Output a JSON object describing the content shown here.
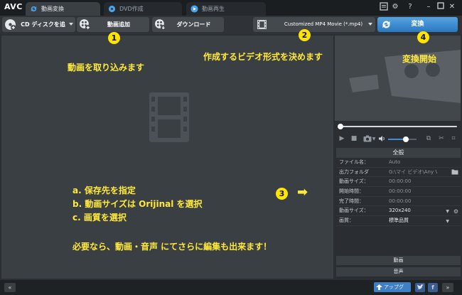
{
  "app": {
    "logo": "AVC"
  },
  "tabs": [
    {
      "label": "動画変換",
      "active": true
    },
    {
      "label": "DVD作成",
      "active": false
    },
    {
      "label": "動画再生",
      "active": false
    }
  ],
  "window_controls": {
    "help": "?"
  },
  "toolbar": {
    "add_cd_label": "CD ディスクを追加",
    "add_video_label": "動画追加",
    "download_label": "ダウンロード",
    "format_label": "Customized MP4 Movie (*.mp4)",
    "convert_label": "変換"
  },
  "props": {
    "header": "全般",
    "rows": [
      {
        "key": "ファイル名：",
        "value": "Auto"
      },
      {
        "key": "出力フォルダ",
        "value": "G:\\マイ ビデオ\\Any Vide..."
      },
      {
        "key": "動画サイズ：",
        "value": "00:00:00"
      },
      {
        "key": "開始時間：",
        "value": "00:00:00"
      },
      {
        "key": "完了時間：",
        "value": "00:00:00"
      },
      {
        "key": "動画サイズ：",
        "value": "320x240"
      },
      {
        "key": "画質：",
        "value": "標準品質"
      }
    ],
    "video_section": "動画",
    "audio_section": "音声"
  },
  "bottom": {
    "upgrade_label": "アップグレ...",
    "nav_left": "«",
    "nav_right": "»"
  },
  "annotations": {
    "n1": "1",
    "n2": "2",
    "n3": "3",
    "n4": "4",
    "import": "動画を取り込みます",
    "format": "作成するビデオ形式を決めます",
    "start": "変換開始",
    "step_a": "a. 保存先を指定",
    "step_b": "b. 動画サイズは Orijinal を選択",
    "step_c": "c. 画質を選択",
    "note": "必要なら、動画・音声 にてさらに編集も出来ます！",
    "arrow": "➡"
  },
  "colors": {
    "accent": "#3d8ed8",
    "annotation": "#ffe93a",
    "panel": "#3a3f44"
  }
}
